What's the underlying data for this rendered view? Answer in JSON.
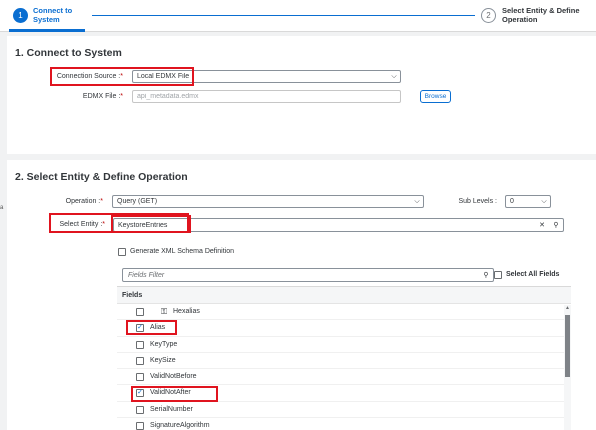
{
  "wizard": {
    "step1": {
      "number": "1",
      "label": "Connect to System"
    },
    "step2": {
      "number": "2",
      "label": "Select Entity & Define Operation"
    }
  },
  "section1": {
    "title": "1. Connect to System",
    "connection_source_label": "Connection Source :",
    "connection_source_value": "Local EDMX File",
    "edmx_file_label": "EDMX File :",
    "edmx_file_placeholder": "api_metadata.edmx",
    "browse_label": "Browse",
    "required_mark": "*"
  },
  "section2": {
    "title": "2. Select Entity & Define Operation",
    "operation_label": "Operation :",
    "operation_value": "Query (GET)",
    "sub_levels_label": "Sub Levels :",
    "sub_levels_value": "0",
    "select_entity_label": "Select Entity :",
    "select_entity_value": "KeystoreEntries",
    "generate_xml_label": "Generate XML Schema Definition",
    "fields_filter_placeholder": "Fields Filter",
    "select_all_label": "Select All Fields",
    "fields_header": "Fields",
    "fields": [
      {
        "label": "Hexalias",
        "checked": false,
        "key": true
      },
      {
        "label": "Alias",
        "checked": true,
        "key": false
      },
      {
        "label": "KeyType",
        "checked": false,
        "key": false
      },
      {
        "label": "KeySize",
        "checked": false,
        "key": false
      },
      {
        "label": "ValidNotBefore",
        "checked": false,
        "key": false
      },
      {
        "label": "ValidNotAfter",
        "checked": true,
        "key": false
      },
      {
        "label": "SerialNumber",
        "checked": false,
        "key": false
      },
      {
        "label": "SignatureAlgorithm",
        "checked": false,
        "key": false
      }
    ]
  },
  "icons": {
    "chevron": "⌵",
    "check": "✓",
    "clear": "✕",
    "search": "⚲",
    "key": "⚿"
  },
  "colors": {
    "accent": "#0a6ed1",
    "highlight": "#e0141f",
    "required": "#bb0000"
  },
  "misc": {
    "side_mark": "a"
  }
}
